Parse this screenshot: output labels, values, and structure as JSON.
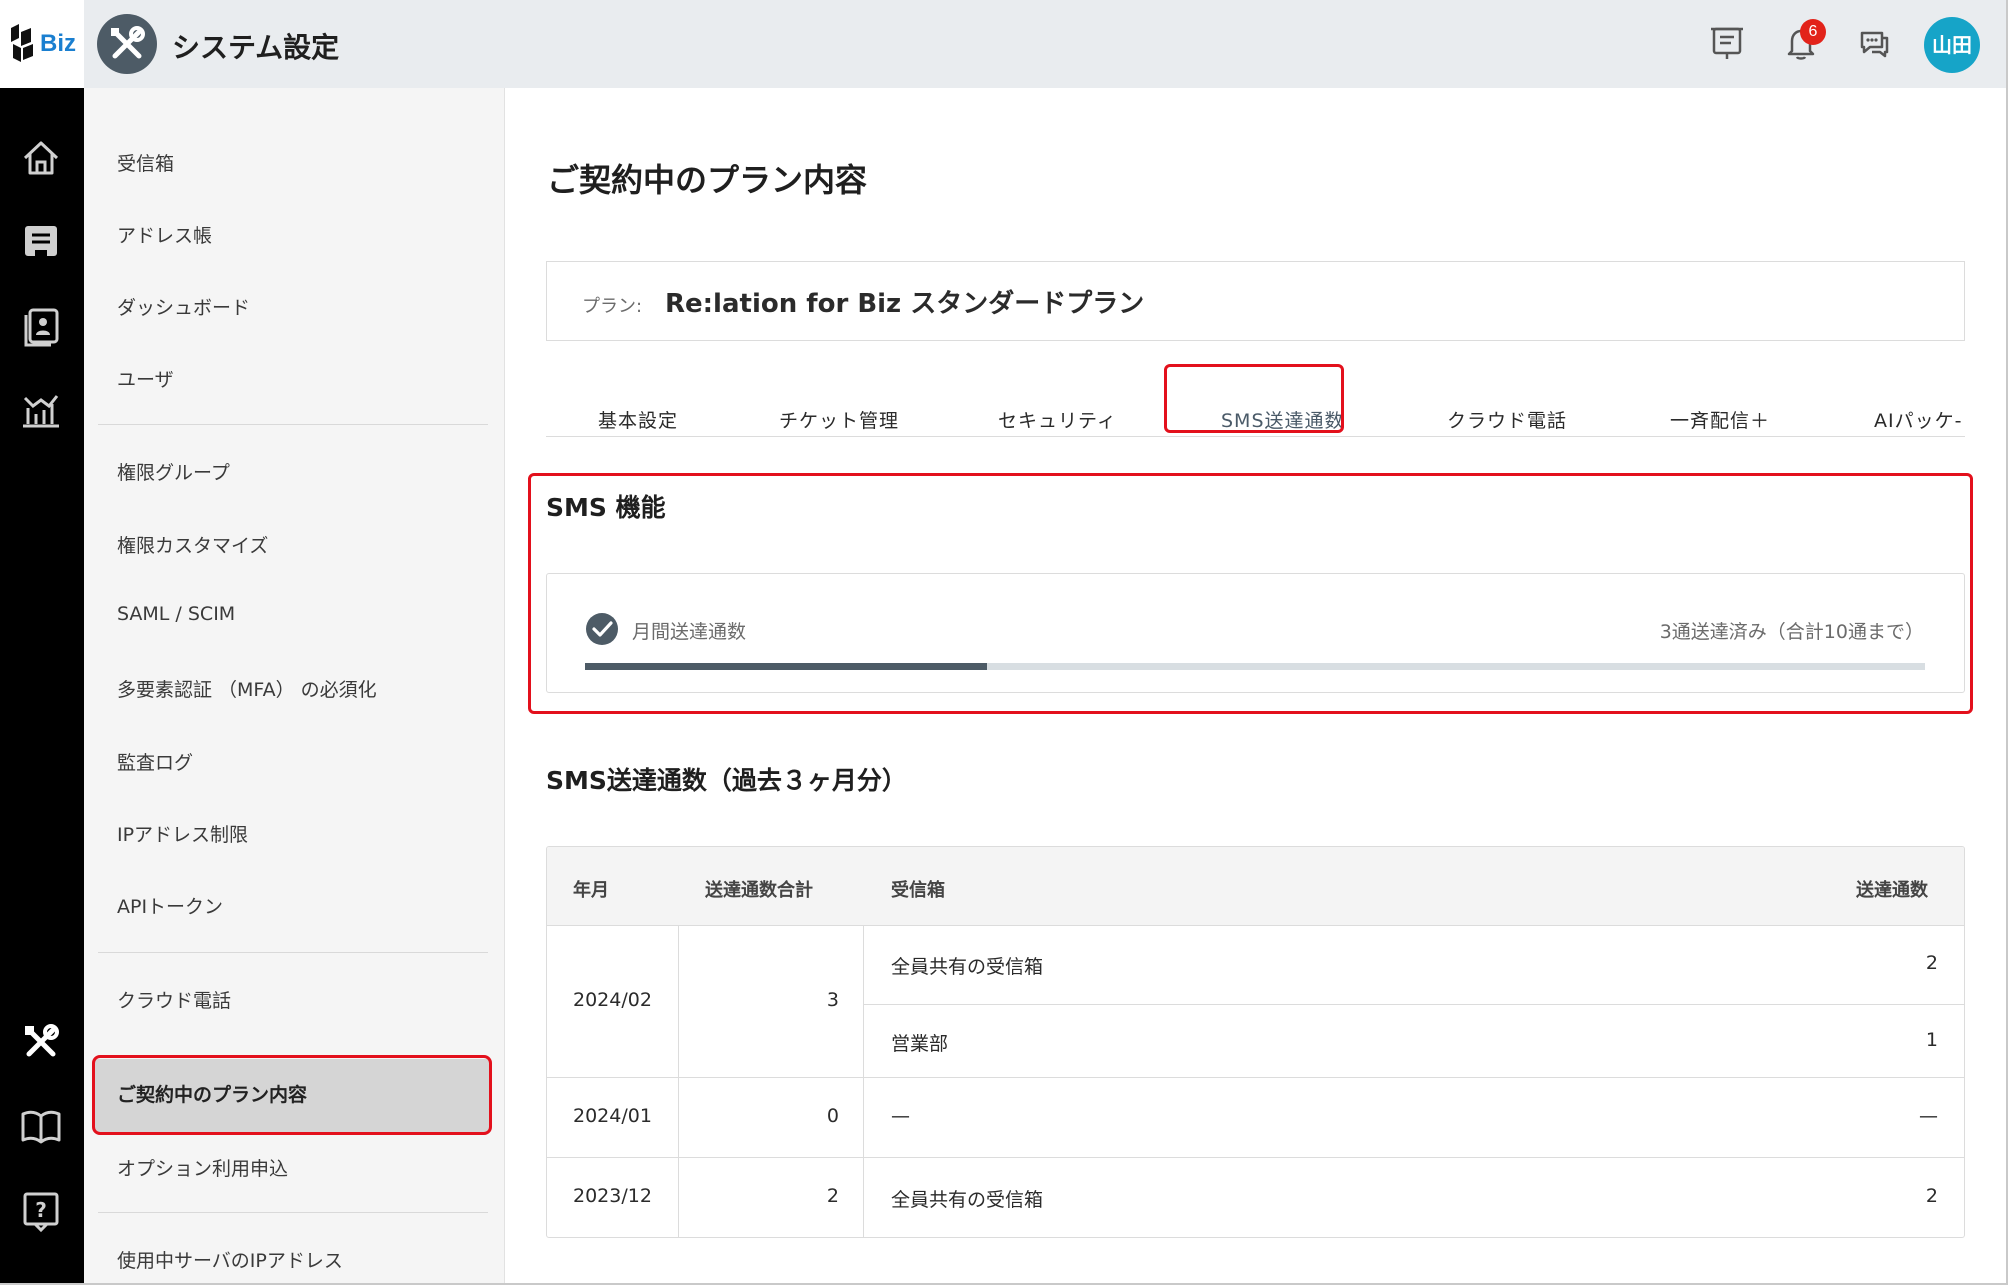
{
  "app": {
    "logo_text": "Biz",
    "section_title": "システム設定",
    "notification_count": "6",
    "user_initials": "山田"
  },
  "rail": {
    "icons": [
      "home-icon",
      "ticket-icon",
      "contacts-icon",
      "dashboard-chart-icon",
      "settings-tools-icon",
      "manual-book-icon",
      "help-icon"
    ]
  },
  "subnav": {
    "items": [
      "受信箱",
      "アドレス帳",
      "ダッシュボード",
      "ユーザ",
      "権限グループ",
      "権限カスタマイズ",
      "SAML / SCIM",
      "多要素認証 （MFA） の必須化",
      "監査ログ",
      "IPアドレス制限",
      "APIトークン",
      "クラウド電話",
      "ご契約中のプラン内容",
      "オプション利用申込",
      "使用中サーバのIPアドレス"
    ],
    "active": "ご契約中のプラン内容"
  },
  "main": {
    "page_title": "ご契約中のプラン内容",
    "plan_label": "プラン:",
    "plan_name": "Re:lation for Biz スタンダードプラン",
    "tabs": [
      "基本設定",
      "チケット管理",
      "セキュリティ",
      "SMS送達通数",
      "クラウド電話",
      "一斉配信＋",
      "AIパッケ-"
    ],
    "active_tab": "SMS送達通数",
    "sms": {
      "title": "SMS 機能",
      "label": "月間送達通数",
      "status": "3通送達済み（合計10通まで）",
      "used": 3,
      "limit": 10
    },
    "history": {
      "title": "SMS送達通数（過去３ヶ月分）",
      "headers": [
        "年月",
        "送達通数合計",
        "受信箱",
        "送達通数"
      ],
      "rows": [
        {
          "month": "2024/02",
          "total": "3",
          "inboxes": [
            {
              "name": "全員共有の受信箱",
              "count": "2"
            },
            {
              "name": "営業部",
              "count": "1"
            }
          ]
        },
        {
          "month": "2024/01",
          "total": "0",
          "inboxes": [
            {
              "name": "—",
              "count": "—"
            }
          ]
        },
        {
          "month": "2023/12",
          "total": "2",
          "inboxes": [
            {
              "name": "全員共有の受信箱",
              "count": "2"
            }
          ]
        }
      ]
    }
  },
  "colors": {
    "accent": "#4d5b66",
    "highlight": "#e3101c",
    "avatar": "#16a4c8",
    "badge": "#e2231a"
  }
}
